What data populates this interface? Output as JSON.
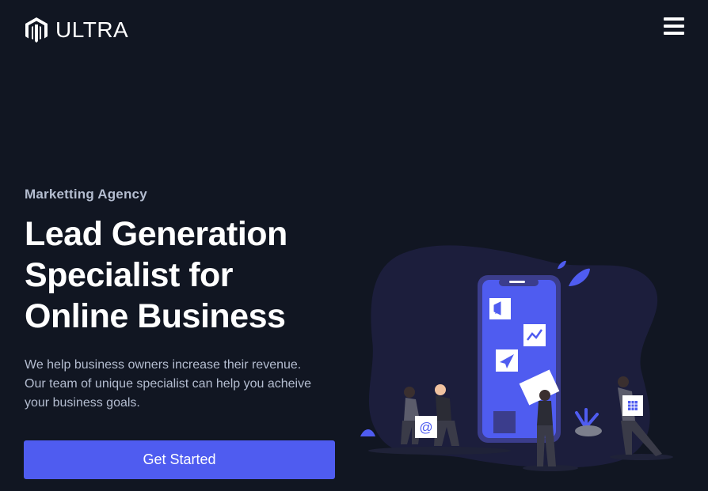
{
  "brand": {
    "name": "ULTRA",
    "logo_icon": "magento-like-hexagon-m-icon"
  },
  "nav": {
    "menu_icon": "hamburger-menu-icon"
  },
  "hero": {
    "eyebrow": "Marketting Agency",
    "title_lines": [
      "Lead Generation",
      "Specialist for",
      "Online Business"
    ],
    "description_lines": [
      "We help business owners increase their revenue.",
      "Our team of unique specialist can help you acheive",
      "your business goals."
    ],
    "cta_label": "Get Started"
  },
  "illustration": {
    "description_icon": "marketing-team-phone-illustration",
    "email_symbol": "@"
  },
  "colors": {
    "background": "#111622",
    "accent": "#4f5cf0",
    "muted_text": "#b4bdd0",
    "blob": "#1c1e3c"
  }
}
